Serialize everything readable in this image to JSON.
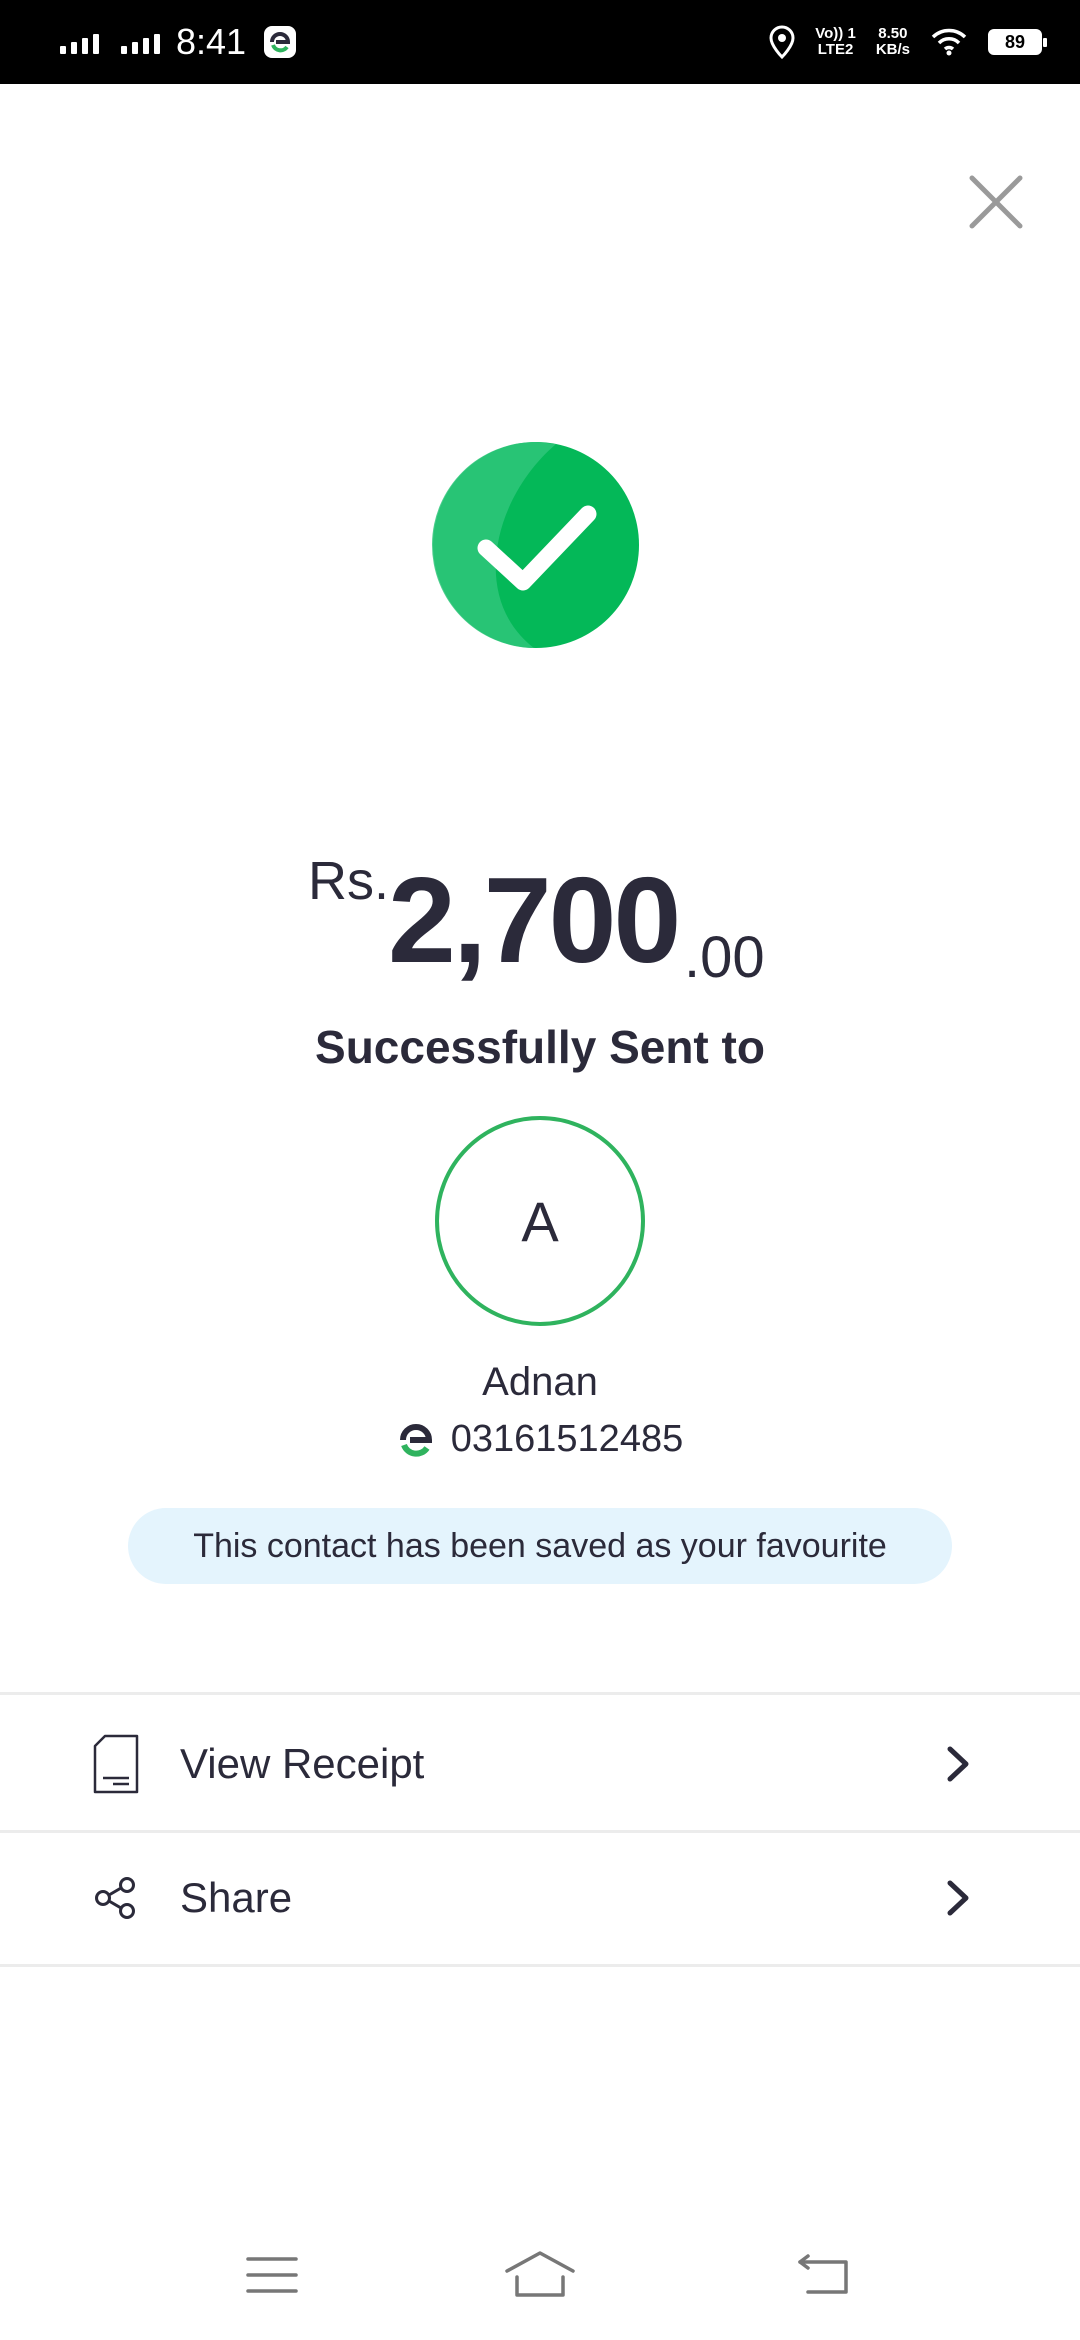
{
  "status_bar": {
    "time": "8:41",
    "network_line1": "Vo)) 1",
    "network_line2": "LTE2",
    "speed_value": "8.50",
    "speed_unit": "KB/s",
    "battery": "89",
    "icons": [
      "signal-icon",
      "signal-icon",
      "easypaisa-app-icon",
      "location-icon",
      "wifi-icon",
      "battery-icon"
    ]
  },
  "close_icon": "close-icon",
  "success_icon": "checkmark-icon",
  "colors": {
    "success_green": "#04b858",
    "avatar_border": "#2fb35e",
    "text": "#2b2a3a",
    "banner_bg": "#e4f4fd"
  },
  "amount": {
    "currency": "Rs.",
    "main": "2,700",
    "decimals": ".00"
  },
  "sent_to_label": "Successfully Sent to",
  "contact": {
    "initial": "A",
    "name": "Adnan",
    "number": "03161512485",
    "wallet_icon": "easypaisa-logo-icon"
  },
  "favourite_message": "This contact has been saved as your favourite",
  "actions": [
    {
      "label": "View Receipt",
      "icon": "receipt-icon"
    },
    {
      "label": "Share",
      "icon": "share-icon"
    }
  ],
  "nav_bar": {
    "icons": [
      "menu-icon",
      "home-icon",
      "back-icon"
    ]
  }
}
